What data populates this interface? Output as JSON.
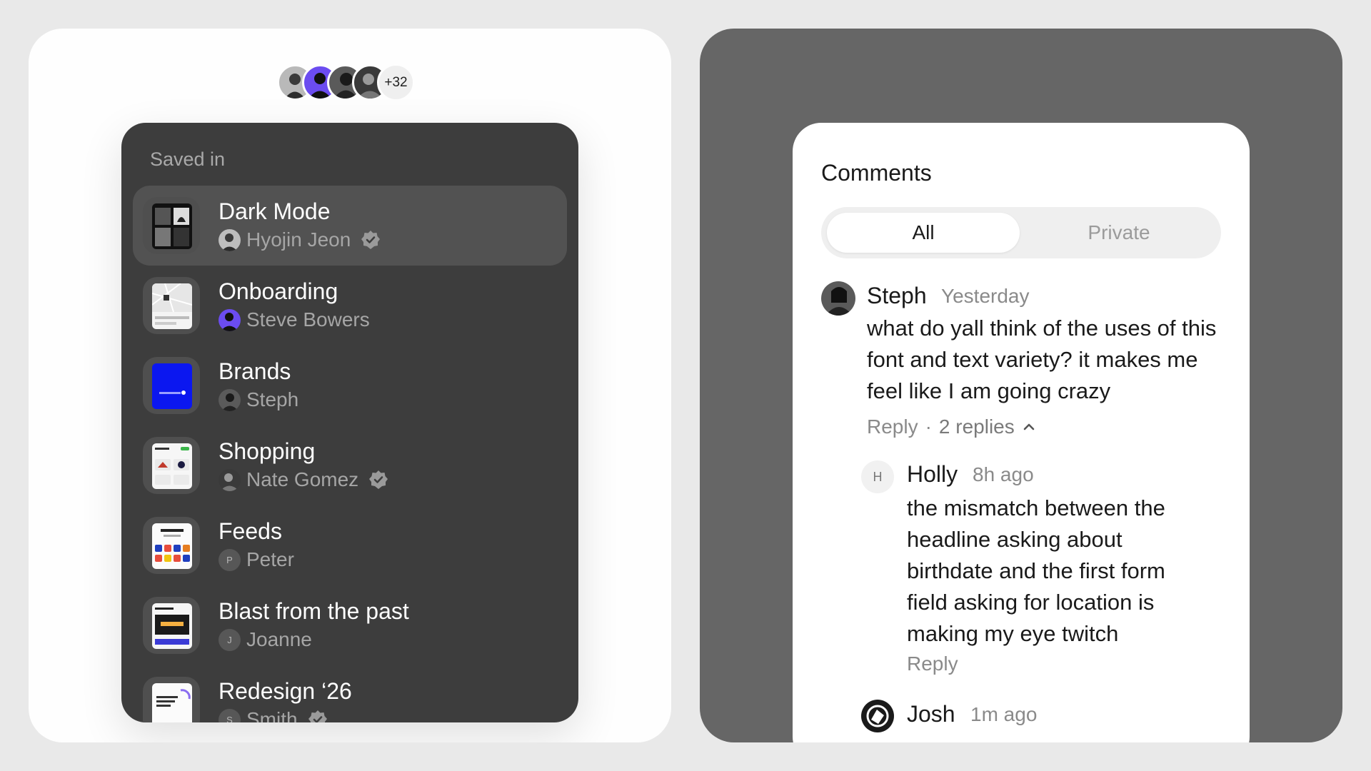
{
  "collaborators": {
    "extra_count": "+32"
  },
  "saved_in": {
    "heading": "Saved in",
    "items": [
      {
        "title": "Dark Mode",
        "owner": "Hyojin Jeon",
        "verified": true,
        "active": true
      },
      {
        "title": "Onboarding",
        "owner": "Steve Bowers",
        "verified": false,
        "active": false
      },
      {
        "title": "Brands",
        "owner": "Steph",
        "verified": false,
        "active": false
      },
      {
        "title": "Shopping",
        "owner": "Nate Gomez",
        "verified": true,
        "active": false
      },
      {
        "title": "Feeds",
        "owner": "Peter",
        "owner_initial": "P",
        "verified": false,
        "active": false
      },
      {
        "title": "Blast from the past",
        "owner": "Joanne",
        "owner_initial": "J",
        "verified": false,
        "active": false
      },
      {
        "title": "Redesign ‘26",
        "owner": "Smith",
        "owner_initial": "S",
        "verified": true,
        "active": false
      }
    ]
  },
  "comments": {
    "title": "Comments",
    "tabs": [
      {
        "label": "All",
        "selected": true
      },
      {
        "label": "Private",
        "selected": false
      }
    ],
    "threads": [
      {
        "author": "Steph",
        "time": "Yesterday",
        "body": "what do yall think of the uses of this font and text variety? it makes me feel like I am going crazy",
        "reply_label": "Reply",
        "separator": "·",
        "replies_label": "2 replies",
        "replies": [
          {
            "author": "Holly",
            "initial": "H",
            "time": "8h ago",
            "body": "the mismatch between the headline asking about birthdate and the first form field asking for location is making my eye twitch",
            "reply_label": "Reply"
          },
          {
            "author": "Josh",
            "time": "1m ago"
          }
        ]
      }
    ]
  },
  "colors": {
    "dark_card": "#3d3d3d",
    "active_row": "#525252",
    "right_panel": "#666666",
    "brand_blue": "#0b17f0",
    "avatar_purple": "#6b4cf0"
  }
}
